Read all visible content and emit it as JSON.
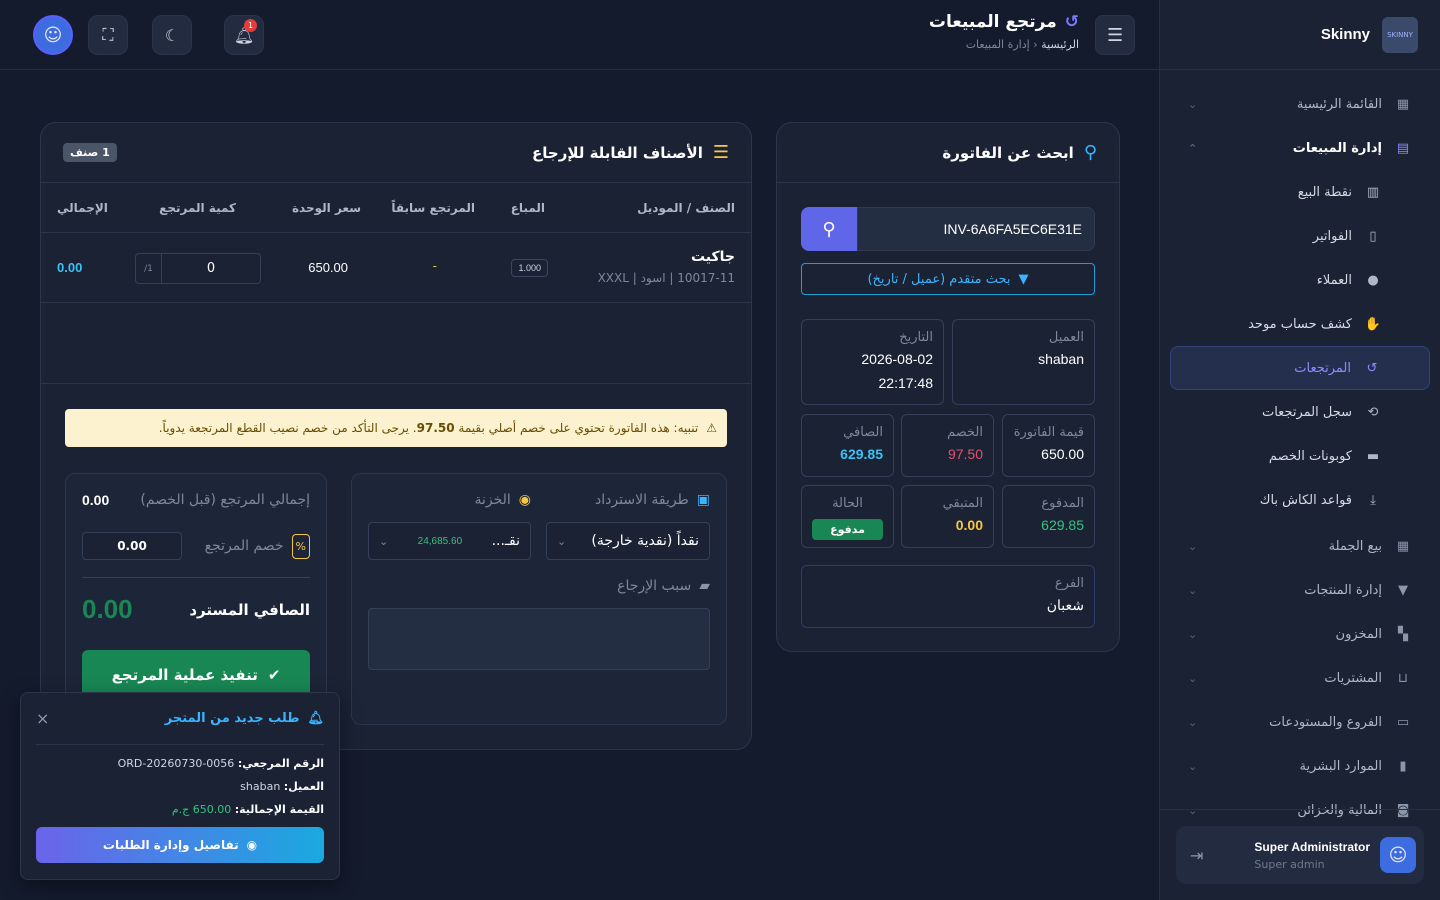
{
  "app": {
    "brand": "Skinny",
    "logo_text": "SKINNY",
    "page_title": "مرتجع المبيعات",
    "breadcrumb": {
      "home": "الرئيسية",
      "separator": "‹",
      "current": "إدارة المبيعات"
    }
  },
  "topbar": {
    "notification_count": "1"
  },
  "sidebar": {
    "items": [
      {
        "label": "القائمة الرئيسية",
        "icon": "grid-icon",
        "chev": "⌄"
      },
      {
        "label": "إدارة المبيعات",
        "icon": "register-icon",
        "chev": "⌃"
      },
      {
        "label": "نقطة البيع",
        "icon": "cash-register-icon"
      },
      {
        "label": "الفواتير",
        "icon": "invoice-icon"
      },
      {
        "label": "العملاء",
        "icon": "users-icon"
      },
      {
        "label": "كشف حساب موحد",
        "icon": "handshake-icon"
      },
      {
        "label": "المرتجعات",
        "icon": "undo-icon"
      },
      {
        "label": "سجل المرتجعات",
        "icon": "history-icon"
      },
      {
        "label": "كوبونات الخصم",
        "icon": "ticket-icon"
      },
      {
        "label": "قواعد الكاش باك",
        "icon": "cashback-icon"
      },
      {
        "label": "بيع الجملة",
        "icon": "warehouse-icon",
        "chev": "⌄"
      },
      {
        "label": "إدارة المنتجات",
        "icon": "shirt-icon",
        "chev": "⌄"
      },
      {
        "label": "المخزون",
        "icon": "boxes-icon",
        "chev": "⌄"
      },
      {
        "label": "المشتريات",
        "icon": "cart-icon",
        "chev": "⌄"
      },
      {
        "label": "الفروع والمستودعات",
        "icon": "store-icon",
        "chev": "⌄"
      },
      {
        "label": "الموارد البشرية",
        "icon": "id-badge-icon",
        "chev": "⌄"
      },
      {
        "label": "المالية والخزائن",
        "icon": "money-icon",
        "chev": "⌄"
      }
    ],
    "user": {
      "name": "Super Administrator",
      "role": "Super admin"
    }
  },
  "invoice_search": {
    "title": "ابحث عن الفاتورة",
    "input_value": "INV-6A6FA5EC6E31E",
    "advanced_label": "بحث متقدم (عميل / تاريخ)",
    "customer": {
      "label": "العميل",
      "value": "shaban"
    },
    "date": {
      "label": "التاريخ",
      "date": "2026-08-02",
      "time": "22:17:48"
    },
    "invoice_value": {
      "label": "قيمة الفاتورة",
      "value": "650.00"
    },
    "discount": {
      "label": "الخصم",
      "value": "97.50"
    },
    "net": {
      "label": "الصافي",
      "value": "629.85"
    },
    "paid": {
      "label": "المدفوع",
      "value": "629.85"
    },
    "remaining": {
      "label": "المتبقي",
      "value": "0.00"
    },
    "status": {
      "label": "الحالة",
      "value": "مدفوع"
    },
    "branch": {
      "label": "الفرع",
      "value": "شعبان"
    }
  },
  "returnable": {
    "title": "الأصناف القابلة للإرجاع",
    "count_badge": "1 صنف",
    "columns": [
      "الصنف / الموديل",
      "المباع",
      "المرتجع سابقاً",
      "سعر الوحدة",
      "كمية المرتجع",
      "الإجمالي"
    ],
    "rows": [
      {
        "name": "جاكيت",
        "details": "10017-11 | اسود | XXXL",
        "sold": "1.000",
        "returned_before": "-",
        "unit_price": "650.00",
        "qty": "0",
        "qty_max": "1/",
        "total": "0.00"
      }
    ]
  },
  "alert": {
    "prefix": "تنبيه:",
    "text_before": "هذه الفاتورة تحتوي على خصم أصلي بقيمة",
    "amount": "97.50",
    "text_after": ". يرجى التأكد من خصم نصيب القطع المرتجعة يدوياً."
  },
  "refund": {
    "method_label": "طريقة الاسترداد",
    "method_value": "نقداً (نقدية خارجة)",
    "safe_label": "الخزنة",
    "safe_value": "نقـ...",
    "safe_balance": "24,685.60",
    "reason_label": "سبب الإرجاع",
    "reason_value": ""
  },
  "summary": {
    "total_before_label": "إجمالي المرتجع (قبل الخصم)",
    "total_before": "0.00",
    "discount_label": "خصم المرتجع",
    "discount_value": "0.00",
    "discount_symbol": "%",
    "net_label": "الصافي المسترد",
    "net_value": "0.00",
    "execute_label": "تنفيذ عملية المرتجع"
  },
  "toast": {
    "title": "طلب جديد من المتجر",
    "close": "×",
    "ref_label": "الرقم المرجعي:",
    "ref_value": "ORD-20260730-0056",
    "customer_label": "العميل:",
    "customer_value": "shaban",
    "total_label": "القيمة الإجمالية:",
    "total_value": "650.00 ج.م",
    "button_label": "تفاصيل وإدارة الطلبات"
  },
  "colors": {
    "accent": "#5f67e8",
    "info": "#3ab4ff",
    "success": "#198754",
    "danger": "#e0526b",
    "warning": "#f6c744",
    "bg": "#141b2d"
  }
}
